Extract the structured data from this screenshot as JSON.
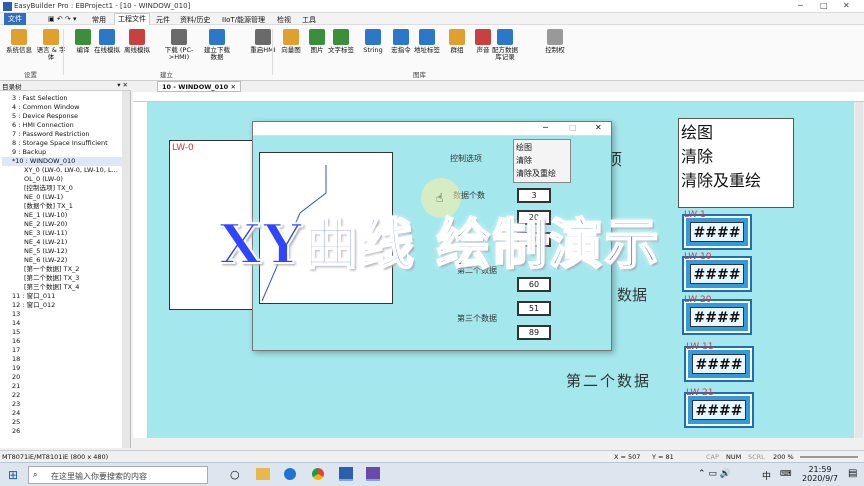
{
  "window": {
    "title": "EasyBuilder Pro : EBProject1 - [10 - WINDOW_010]"
  },
  "menu": [
    "文件",
    "常用",
    "工程文件",
    "元件",
    "资料/历史",
    "IIoT/能源管理",
    "检视",
    "工具"
  ],
  "ribbon": {
    "buttons": [
      {
        "label": "系统信息",
        "color": "#e0a030"
      },
      {
        "label": "语言 & 字体",
        "color": "#e0a030"
      },
      {
        "label": "编译",
        "color": "#3b8f3b"
      },
      {
        "label": "在线模拟",
        "color": "#2d77c8"
      },
      {
        "label": "离线模拟",
        "color": "#c84040"
      },
      {
        "label": "下载 (PC->HMI)",
        "color": "#6a6a6a"
      },
      {
        "label": "建立下载数据",
        "color": "#2d77c8"
      },
      {
        "label": "重启HMI",
        "color": "#6a6a6a"
      },
      {
        "label": "向量图",
        "color": "#e0a030"
      },
      {
        "label": "图片",
        "color": "#3b8f3b"
      },
      {
        "label": "文字标签",
        "color": "#3b8f3b"
      },
      {
        "label": "String",
        "color": "#2d77c8"
      },
      {
        "label": "宏指令",
        "color": "#2d77c8"
      },
      {
        "label": "地址标签",
        "color": "#2d77c8"
      },
      {
        "label": "群组",
        "color": "#e0a030"
      },
      {
        "label": "声音",
        "color": "#c84040"
      },
      {
        "label": "配方数据库记录",
        "color": "#2d77c8"
      },
      {
        "label": "控制权",
        "color": "#999999"
      }
    ],
    "groups": [
      "设置",
      "建立",
      "图库"
    ]
  },
  "left_panel": {
    "header": "目录树",
    "items": [
      "3 : Fast Selection",
      "4 : Common Window",
      "5 : Device Response",
      "6 : HMI Connection",
      "7 : Password Restriction",
      "8 : Storage Space Insufficient",
      "9 : Backup",
      "*10 : WINDOW_010",
      "XY_0 (LW-0, LW-0, LW-10, L...",
      "OL_0 (LW-0)",
      "[控制选项] TX_0",
      "NE_0 (LW-1)",
      "[数据个数] TX_1",
      "NE_1 (LW-10)",
      "NE_2 (LW-20)",
      "NE_3 (LW-11)",
      "NE_4 (LW-21)",
      "NE_5 (LW-12)",
      "NE_6 (LW-22)",
      "[第一个数据] TX_2",
      "[第二个数据] TX_3",
      "[第三个数据] TX_4",
      "11 : 窗口_011",
      "12 : 窗口_012",
      "13",
      "14",
      "15",
      "16",
      "17",
      "18",
      "19",
      "20",
      "21",
      "22",
      "23",
      "24",
      "25",
      "26"
    ]
  },
  "tab": {
    "label": "10 - WINDOW_010"
  },
  "canvas": {
    "lw0_label": "LW-0",
    "heading_right": "项",
    "label_data": "数据",
    "label_second": "第二个数据",
    "menu_items": [
      "绘图",
      "清除",
      "清除及重绘"
    ],
    "hash_boxes": [
      {
        "tag": "LW-1",
        "text": "####"
      },
      {
        "tag": "LW-10",
        "text": "####"
      },
      {
        "tag": "LW-20",
        "text": "####"
      },
      {
        "tag": "LW-11",
        "text": "####"
      },
      {
        "tag": "LW-21",
        "text": "####"
      }
    ]
  },
  "dialog": {
    "control_label": "控制选项",
    "options": [
      "绘图",
      "清除",
      "清除及重绘"
    ],
    "count_label": "数据个数",
    "count_value": "3",
    "field2_value": "20",
    "field3_value": "0",
    "second_label": "第二个数据",
    "third_label": "第三个数据",
    "values": [
      "60",
      "51",
      "89"
    ]
  },
  "overlay": {
    "text": "XY曲线 绘制演示"
  },
  "statusbar": {
    "model": "MT8071iE/MT8101iE (800 x 480)",
    "x": "X = 507",
    "y": "Y = 81",
    "cap": "CAP",
    "num": "NUM",
    "scrl": "SCRL",
    "zoom": "200 %"
  },
  "taskbar": {
    "search_placeholder": "在这里输入你要搜索的内容",
    "time": "21:59",
    "date": "2020/9/7",
    "ime": "中"
  }
}
